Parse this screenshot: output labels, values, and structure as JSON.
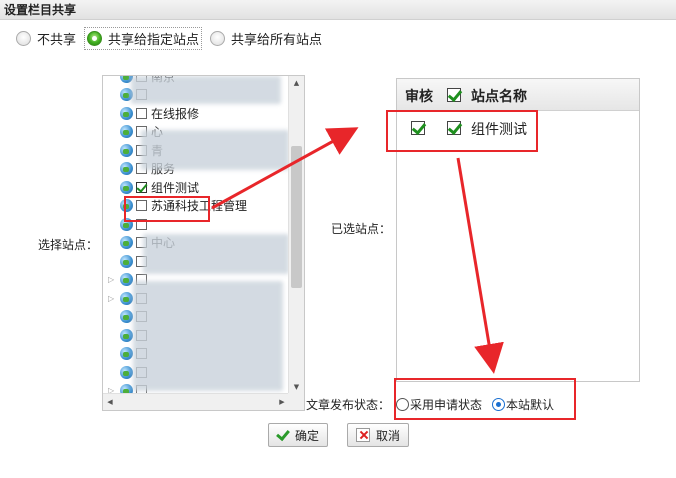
{
  "dialog": {
    "title": "设置栏目共享"
  },
  "share_options": [
    {
      "label": "不共享",
      "selected": false
    },
    {
      "label": "共享给指定站点",
      "selected": true
    },
    {
      "label": "共享给所有站点",
      "selected": false
    }
  ],
  "select_site_label": "选择站点：",
  "tree": {
    "items": [
      {
        "label": "南京",
        "checked": false
      },
      {
        "label": "",
        "checked": false
      },
      {
        "label": "在线报修",
        "checked": false
      },
      {
        "label": "心",
        "checked": false
      },
      {
        "label": "青",
        "checked": false
      },
      {
        "label": "服务",
        "checked": false
      },
      {
        "label": "组件测试",
        "checked": true
      },
      {
        "label": "苏通科技工程管理",
        "checked": false
      },
      {
        "label": "",
        "checked": false
      },
      {
        "label": "中心",
        "checked": false
      },
      {
        "label": "",
        "checked": false
      },
      {
        "label": "",
        "checked": false
      },
      {
        "label": "",
        "checked": false
      },
      {
        "label": "",
        "checked": false
      },
      {
        "label": "",
        "checked": false
      },
      {
        "label": "",
        "checked": false
      },
      {
        "label": "",
        "checked": false
      },
      {
        "label": "",
        "checked": false
      }
    ]
  },
  "selected_sites_label": "已选站点：",
  "selected_table": {
    "col_audit": "审核",
    "col_name": "站点名称",
    "rows": [
      {
        "audit": true,
        "checked": true,
        "name": "组件测试"
      }
    ]
  },
  "publish_status": {
    "label": "文章发布状态：",
    "options": [
      {
        "label": "采用申请状态",
        "selected": false
      },
      {
        "label": "本站默认",
        "selected": true
      }
    ]
  },
  "buttons": {
    "ok": "确定",
    "cancel": "取消"
  },
  "colors": {
    "highlight": "#e8262a",
    "check": "#1e8f1e"
  }
}
